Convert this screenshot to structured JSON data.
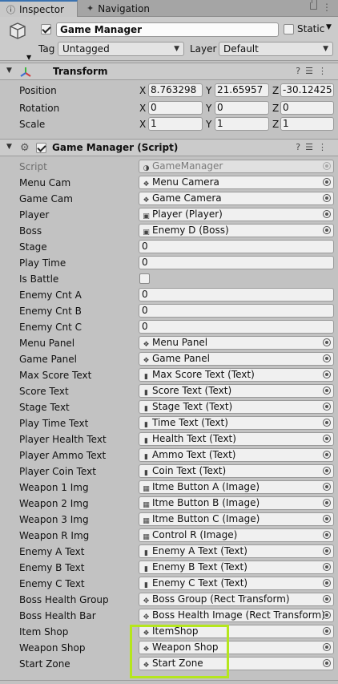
{
  "tabs": {
    "inspector": "Inspector",
    "navigation": "Navigation"
  },
  "object": {
    "name": "Game Manager",
    "static_label": "Static",
    "tag_label": "Tag",
    "tag_value": "Untagged",
    "layer_label": "Layer",
    "layer_value": "Default"
  },
  "transform": {
    "title": "Transform",
    "rows": [
      {
        "label": "Position",
        "x": "8.763298",
        "y": "21.65957",
        "z": "-30.12425"
      },
      {
        "label": "Rotation",
        "x": "0",
        "y": "0",
        "z": "0"
      },
      {
        "label": "Scale",
        "x": "1",
        "y": "1",
        "z": "1"
      }
    ],
    "axis": {
      "x": "X",
      "y": "Y",
      "z": "Z"
    }
  },
  "script_component": {
    "title": "Game Manager (Script)",
    "script_label": "Script",
    "script_value": "GameManager",
    "fields": [
      {
        "label": "Menu Cam",
        "value": "Menu Camera",
        "icon": "cube"
      },
      {
        "label": "Game Cam",
        "value": "Game Camera",
        "icon": "cube"
      },
      {
        "label": "Player",
        "value": "Player (Player)",
        "icon": "script"
      },
      {
        "label": "Boss",
        "value": "Enemy D (Boss)",
        "icon": "script"
      },
      {
        "label": "Stage",
        "value": "0",
        "icon": "none"
      },
      {
        "label": "Play Time",
        "value": "0",
        "icon": "none"
      },
      {
        "label": "Is Battle",
        "value": "",
        "icon": "checkbox"
      },
      {
        "label": "Enemy Cnt A",
        "value": "0",
        "icon": "none"
      },
      {
        "label": "Enemy Cnt B",
        "value": "0",
        "icon": "none"
      },
      {
        "label": "Enemy Cnt C",
        "value": "0",
        "icon": "none"
      },
      {
        "label": "Menu Panel",
        "value": "Menu Panel",
        "icon": "cube"
      },
      {
        "label": "Game Panel",
        "value": "Game Panel",
        "icon": "cube"
      },
      {
        "label": "Max Score Text",
        "value": "Max Score Text (Text)",
        "icon": "text"
      },
      {
        "label": "Score Text",
        "value": "Score Text (Text)",
        "icon": "text"
      },
      {
        "label": "Stage Text",
        "value": "Stage Text (Text)",
        "icon": "text"
      },
      {
        "label": "Play Time Text",
        "value": "Time Text  (Text)",
        "icon": "text"
      },
      {
        "label": "Player Health Text",
        "value": "Health Text (Text)",
        "icon": "text"
      },
      {
        "label": "Player Ammo Text",
        "value": "Ammo Text  (Text)",
        "icon": "text"
      },
      {
        "label": "Player Coin Text",
        "value": "Coin Text  (Text)",
        "icon": "text"
      },
      {
        "label": "Weapon 1 Img",
        "value": "Itme Button A (Image)",
        "icon": "image"
      },
      {
        "label": "Weapon 2 Img",
        "value": "Itme Button B (Image)",
        "icon": "image"
      },
      {
        "label": "Weapon 3 Img",
        "value": "Itme Button C (Image)",
        "icon": "image"
      },
      {
        "label": "Weapon R Img",
        "value": "Control R (Image)",
        "icon": "image"
      },
      {
        "label": "Enemy A Text",
        "value": "Enemy A Text (Text)",
        "icon": "text"
      },
      {
        "label": "Enemy B Text",
        "value": "Enemy B Text  (Text)",
        "icon": "text"
      },
      {
        "label": "Enemy C Text",
        "value": "Enemy C Text  (Text)",
        "icon": "text"
      },
      {
        "label": "Boss Health Group",
        "value": "Boss Group (Rect Transform)",
        "icon": "rect"
      },
      {
        "label": "Boss Health Bar",
        "value": "Boss Health Image (Rect Transform)",
        "icon": "rect"
      },
      {
        "label": "Item Shop",
        "value": "ItemShop",
        "icon": "cube"
      },
      {
        "label": "Weapon Shop",
        "value": "Weapon Shop",
        "icon": "cube"
      },
      {
        "label": "Start Zone",
        "value": "Start Zone",
        "icon": "cube"
      }
    ]
  },
  "colors": {
    "highlight": "#b5e61d",
    "tab_accent": "#3a72b0"
  }
}
